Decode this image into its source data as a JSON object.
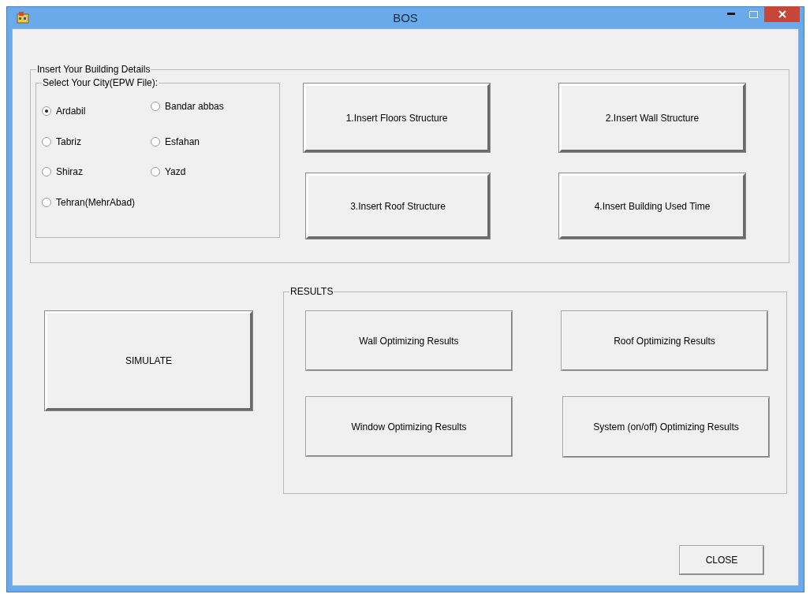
{
  "window": {
    "title": "BOS"
  },
  "details_group": {
    "legend": "Insert Your Building Details"
  },
  "city_group": {
    "legend": "Select Your City(EPW File):",
    "cities": [
      {
        "label": "Ardabil",
        "selected": true
      },
      {
        "label": "Bandar abbas",
        "selected": false
      },
      {
        "label": "Tabriz",
        "selected": false
      },
      {
        "label": "Esfahan",
        "selected": false
      },
      {
        "label": "Shiraz",
        "selected": false
      },
      {
        "label": "Yazd",
        "selected": false
      },
      {
        "label": "Tehran(MehrAbad)",
        "selected": false
      }
    ]
  },
  "structure_buttons": [
    "1.Insert Floors Structure",
    "2.Insert Wall Structure",
    "3.Insert Roof Structure",
    "4.Insert Building Used Time"
  ],
  "simulate_button": "SIMULATE",
  "results_group": {
    "legend": "RESULTS",
    "buttons": [
      "Wall Optimizing Results",
      "Roof Optimizing Results",
      "Window Optimizing Results",
      "System (on/off) Optimizing Results"
    ]
  },
  "close_button": "CLOSE"
}
